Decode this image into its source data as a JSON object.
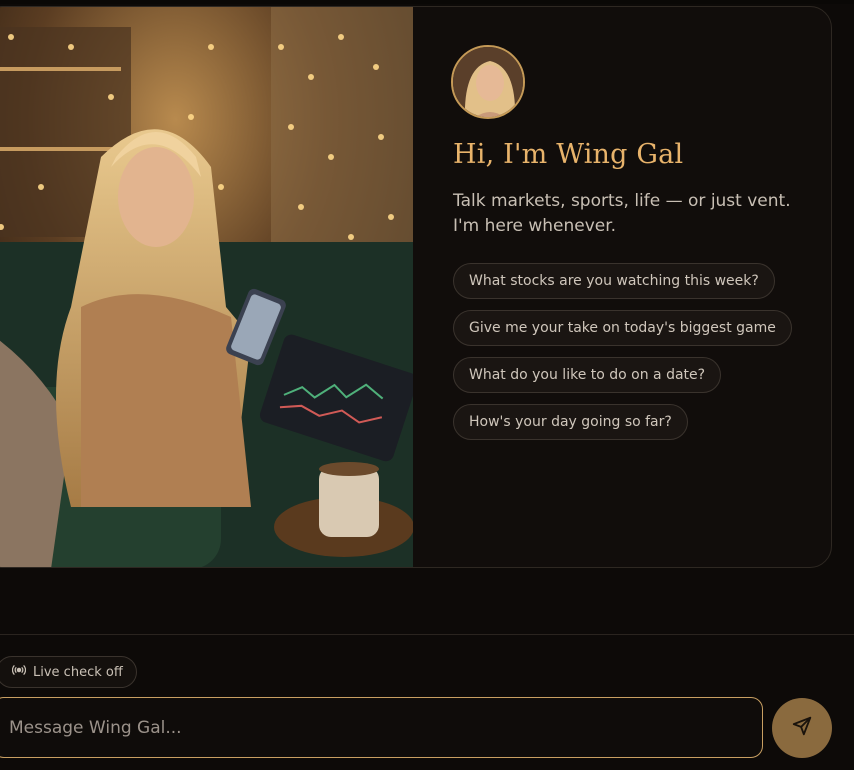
{
  "assistant": {
    "name": "Wing Gal",
    "greeting": "Hi, I'm Wing Gal",
    "intro": "Talk markets, sports, life — or just vent. I'm here whenever."
  },
  "suggestions": [
    "What stocks are you watching this week?",
    "Give me your take on today's biggest game",
    "What do you like to do on a date?",
    "How's your day going so far?"
  ],
  "live_toggle": {
    "label": "Live check off",
    "icon": "broadcast-icon"
  },
  "composer": {
    "placeholder": "Message Wing Gal...",
    "send_icon": "send-icon"
  },
  "colors": {
    "background": "#0d0a08",
    "accent": "#e8b36b",
    "composer_border": "#c89f62",
    "send_button": "#8a6a3e"
  }
}
